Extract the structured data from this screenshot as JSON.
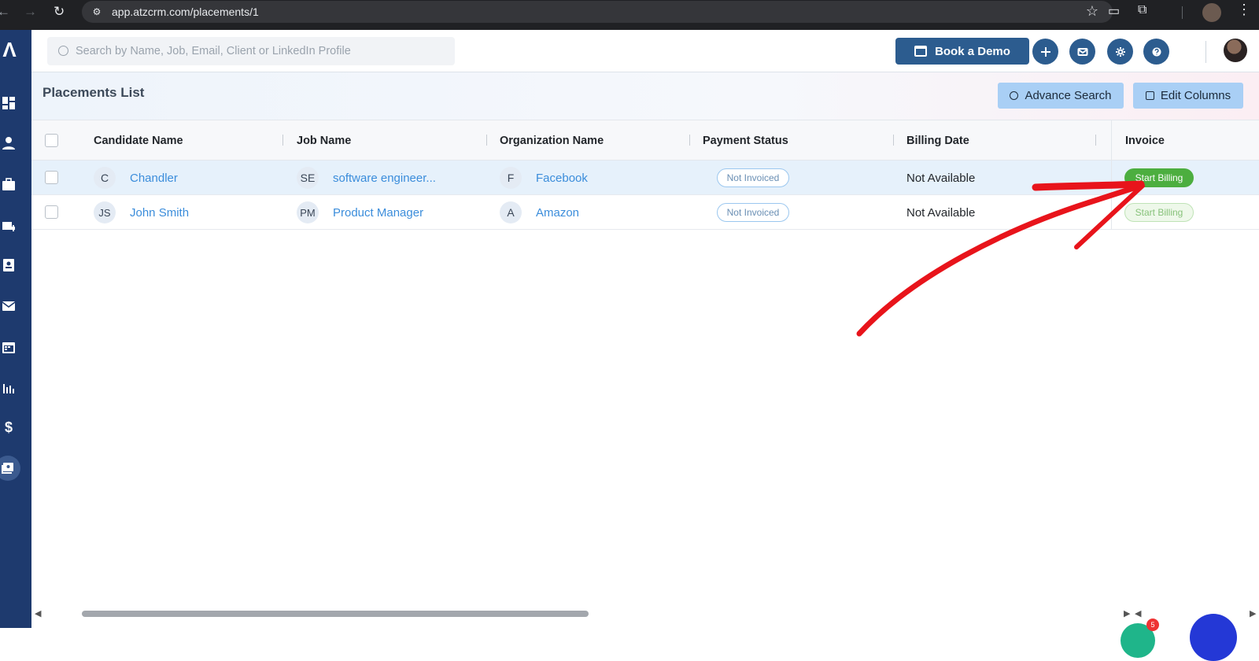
{
  "browser": {
    "url": "app.atzcrm.com/placements/1"
  },
  "topbar": {
    "search_placeholder": "Search by Name, Job, Email, Client or LinkedIn Profile",
    "demo_label": "Book a Demo"
  },
  "header": {
    "title": "Placements List",
    "advance_search_label": "Advance Search",
    "edit_columns_label": "Edit Columns"
  },
  "table": {
    "columns": [
      "Candidate Name",
      "Job Name",
      "Organization Name",
      "Payment Status",
      "Billing Date",
      "Invoice"
    ],
    "rows": [
      {
        "candidate_initials": "C",
        "candidate": "Chandler",
        "job_initials": "SE",
        "job": "software engineer...",
        "org_initials": "F",
        "org": "Facebook",
        "payment_status": "Not Invoiced",
        "billing_date": "Not Available",
        "invoice_action": "Start Billing"
      },
      {
        "candidate_initials": "JS",
        "candidate": "John Smith",
        "job_initials": "PM",
        "job": "Product Manager",
        "org_initials": "A",
        "org": "Amazon",
        "payment_status": "Not Invoiced",
        "billing_date": "Not Available",
        "invoice_action": "Start Billing"
      }
    ]
  },
  "notifications": {
    "badge_count": "5"
  },
  "colors": {
    "rail": "#1e3a6e",
    "primary": "#2c5c8f",
    "link": "#3b8ddb",
    "start_billing": "#4cae3f",
    "annotation": "#e8141b"
  },
  "icons": {
    "rail": [
      "logo-icon",
      "dashboard-icon",
      "candidate-icon",
      "jobs-icon",
      "company-icon",
      "contacts-icon",
      "email-icon",
      "calendar-icon",
      "reports-icon",
      "dollar-icon",
      "placements-icon"
    ]
  }
}
